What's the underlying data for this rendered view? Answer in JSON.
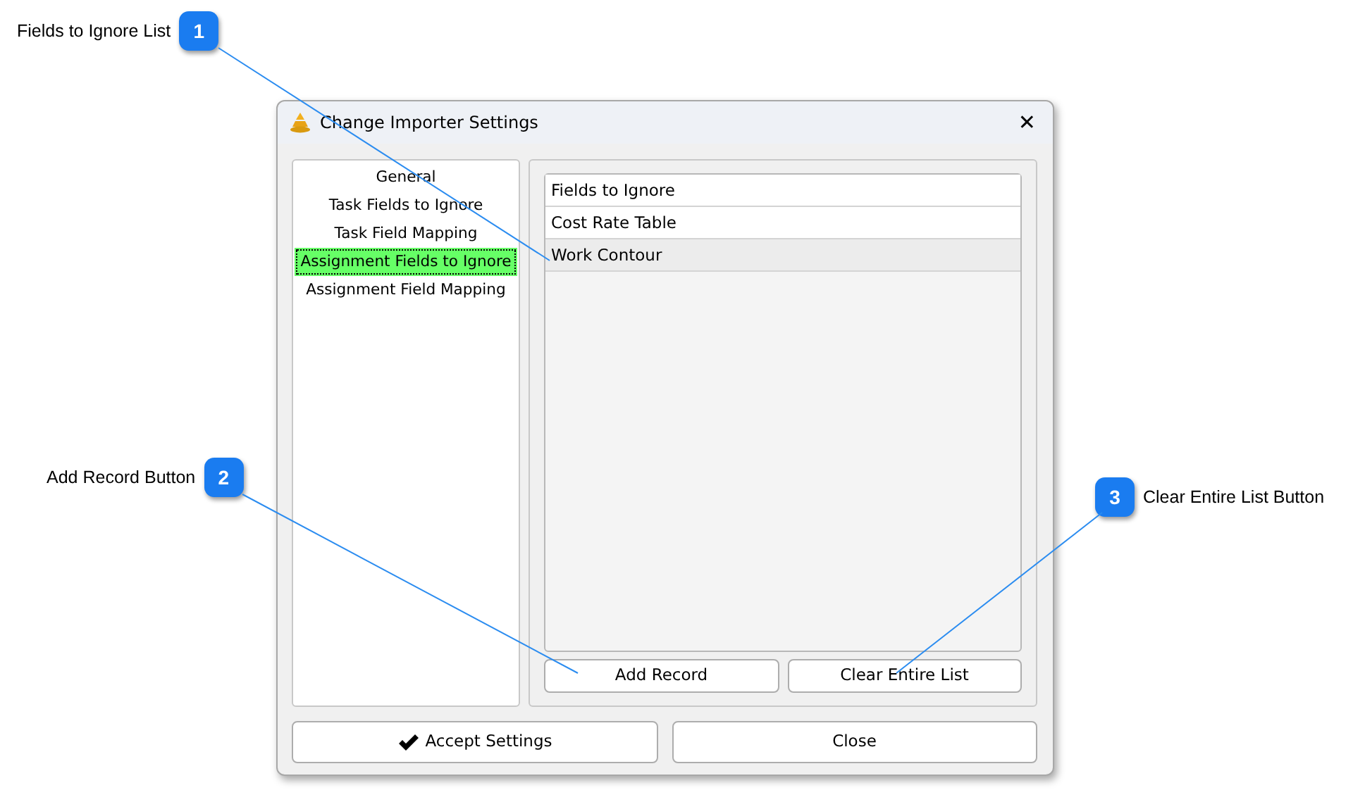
{
  "callouts": [
    {
      "number": "1",
      "label": "Fields to Ignore List"
    },
    {
      "number": "2",
      "label": "Add Record Button"
    },
    {
      "number": "3",
      "label": "Clear Entire List Button"
    }
  ],
  "window": {
    "title": "Change Importer Settings",
    "close": "✕"
  },
  "sidebar": {
    "items": [
      {
        "label": "General",
        "selected": false
      },
      {
        "label": "Task Fields to Ignore",
        "selected": false
      },
      {
        "label": "Task Field Mapping",
        "selected": false
      },
      {
        "label": "Assignment Fields to Ignore",
        "selected": true
      },
      {
        "label": "Assignment Field Mapping",
        "selected": false
      }
    ]
  },
  "table": {
    "header": "Fields to Ignore",
    "rows": [
      {
        "cell": "Cost Rate Table",
        "selected": false
      },
      {
        "cell": "Work Contour",
        "selected": true
      }
    ]
  },
  "panel_buttons": [
    "Add Record",
    "Clear Entire List"
  ],
  "buttons": [
    {
      "label": "Accept Settings",
      "kind": "accept"
    },
    {
      "label": "Close",
      "kind": "plain"
    }
  ]
}
